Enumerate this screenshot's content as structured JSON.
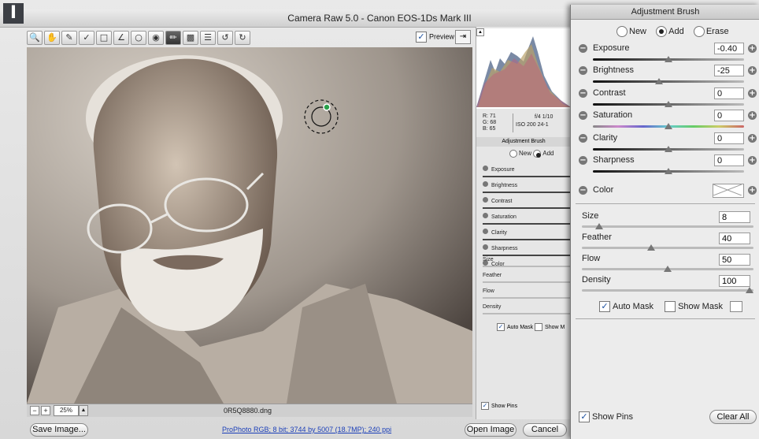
{
  "step_badge": "I",
  "window": {
    "title": "Camera Raw 5.0  -  Canon EOS-1Ds Mark III"
  },
  "toolbar": {
    "tools": [
      "zoom-icon",
      "hand-icon",
      "white-balance-icon",
      "color-sampler-icon",
      "crop-icon",
      "straighten-icon",
      "spot-removal-icon",
      "red-eye-icon",
      "adjustment-brush-icon",
      "graduated-filter-icon",
      "preferences-icon",
      "rotate-left-icon",
      "rotate-right-icon"
    ],
    "preview_label": "Preview",
    "preview_checked": true
  },
  "bottom_bar": {
    "zoom": "25%",
    "filename": "0R5Q8880.dng",
    "workflow_link": "ProPhoto RGB; 8 bit; 3744 by 5007 (18.7MP); 240 ppi",
    "save_label": "Save Image...",
    "open_label": "Open Image",
    "cancel_label": "Cancel"
  },
  "mid_panel": {
    "rgb": {
      "r_label": "R:",
      "r": "71",
      "g_label": "G:",
      "g": "68",
      "b_label": "B:",
      "b": "65"
    },
    "camera": {
      "aperture": "f/4",
      "shutter": "1/10",
      "iso": "ISO 200",
      "focal": "24-1"
    },
    "title": "Adjustment Brush",
    "modes": [
      "New",
      "Add"
    ],
    "sliders": [
      "Exposure",
      "Brightness",
      "Contrast",
      "Saturation",
      "Clarity",
      "Sharpness",
      "Color"
    ],
    "brush": [
      "Size",
      "Feather",
      "Flow",
      "Density"
    ],
    "auto_mask": "Auto Mask",
    "show_mask": "Show M",
    "show_pins": "Show Pins"
  },
  "front_panel": {
    "title": "Adjustment Brush",
    "modes": [
      {
        "label": "New",
        "selected": false
      },
      {
        "label": "Add",
        "selected": true
      },
      {
        "label": "Erase",
        "selected": false
      }
    ],
    "adjustments": [
      {
        "label": "Exposure",
        "value": "-0.40",
        "pos": 0.5
      },
      {
        "label": "Brightness",
        "value": "-25",
        "pos": 0.44
      },
      {
        "label": "Contrast",
        "value": "0",
        "pos": 0.5
      },
      {
        "label": "Saturation",
        "value": "0",
        "pos": 0.5
      },
      {
        "label": "Clarity",
        "value": "0",
        "pos": 0.5
      },
      {
        "label": "Sharpness",
        "value": "0",
        "pos": 0.5
      }
    ],
    "color_label": "Color",
    "brush": [
      {
        "label": "Size",
        "value": "8",
        "pos": 0.08
      },
      {
        "label": "Feather",
        "value": "40",
        "pos": 0.4
      },
      {
        "label": "Flow",
        "value": "50",
        "pos": 0.5
      },
      {
        "label": "Density",
        "value": "100",
        "pos": 1.0
      }
    ],
    "auto_mask": {
      "label": "Auto Mask",
      "checked": true
    },
    "show_mask": {
      "label": "Show Mask",
      "checked": false
    },
    "show_pins": {
      "label": "Show Pins",
      "checked": true
    },
    "clear_all": "Clear All"
  }
}
